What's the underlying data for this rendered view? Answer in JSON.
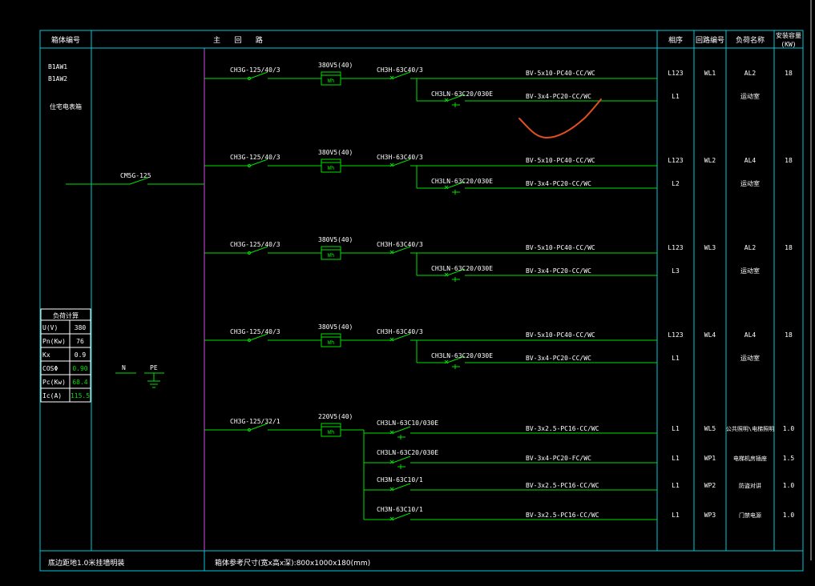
{
  "colors": {
    "background": "#000000",
    "frame": "#00c8d8",
    "wire": "#00e000",
    "busbar": "#b040c0",
    "text": "#ffffff",
    "annotation": "#e05020"
  },
  "header": {
    "col1": "箱体编号",
    "col2": "主 回 路",
    "col3": "相序",
    "col4": "回路编号",
    "col5": "负荷名称",
    "col6a": "安装容量",
    "col6b": "(KW)"
  },
  "left_panel": {
    "line1": "B1AW1",
    "line2": "B1AW2",
    "line3": "住宅电表箱",
    "main_breaker": "CM5G-125",
    "n_label": "N",
    "pe_label": "PE"
  },
  "calc_table": {
    "title": "负荷计算",
    "rows": [
      {
        "label": "U(V)",
        "value": "380"
      },
      {
        "label": "Pn(Kw)",
        "value": "76"
      },
      {
        "label": "Kx",
        "value": "0.9"
      },
      {
        "label": "COSΦ",
        "value": "0.90"
      },
      {
        "label": "Pc(Kw)",
        "value": "68.4"
      },
      {
        "label": "Ic(A)",
        "value": "115.5"
      }
    ]
  },
  "groups": [
    {
      "breaker": "CH3G-125/40/3",
      "meter": "380V5(40)",
      "meter_icon": "Wh",
      "main_sw": "CH3H-63C40/3",
      "main_cable": "BV-5x10-PC40-CC/WC",
      "main_phase": "L123",
      "circuit": "WL1",
      "load": "AL2",
      "capacity": "18",
      "sub_sw": "CH3LN-63C20/030E",
      "sub_cable": "BV-3x4-PC20-CC/WC",
      "sub_phase": "L1",
      "sub_load": "运动室"
    },
    {
      "breaker": "CH3G-125/40/3",
      "meter": "380V5(40)",
      "meter_icon": "Wh",
      "main_sw": "CH3H-63C40/3",
      "main_cable": "BV-5x10-PC40-CC/WC",
      "main_phase": "L123",
      "circuit": "WL2",
      "load": "AL4",
      "capacity": "18",
      "sub_sw": "CH3LN-63C20/030E",
      "sub_cable": "BV-3x4-PC20-CC/WC",
      "sub_phase": "L2",
      "sub_load": "运动室"
    },
    {
      "breaker": "CH3G-125/40/3",
      "meter": "380V5(40)",
      "meter_icon": "Wh",
      "main_sw": "CH3H-63C40/3",
      "main_cable": "BV-5x10-PC40-CC/WC",
      "main_phase": "L123",
      "circuit": "WL3",
      "load": "AL2",
      "capacity": "18",
      "sub_sw": "CH3LN-63C20/030E",
      "sub_cable": "BV-3x4-PC20-CC/WC",
      "sub_phase": "L3",
      "sub_load": "运动室"
    },
    {
      "breaker": "CH3G-125/40/3",
      "meter": "380V5(40)",
      "meter_icon": "Wh",
      "main_sw": "CH3H-63C40/3",
      "main_cable": "BV-5x10-PC40-CC/WC",
      "main_phase": "L123",
      "circuit": "WL4",
      "load": "AL4",
      "capacity": "18",
      "sub_sw": "CH3LN-63C20/030E",
      "sub_cable": "BV-3x4-PC20-CC/WC",
      "sub_phase": "L1",
      "sub_load": "运动室"
    }
  ],
  "group5": {
    "breaker": "CH3G-125/32/1",
    "meter": "220V5(40)",
    "meter_icon": "Wh",
    "branches": [
      {
        "switch": "CH3LN-63C10/030E",
        "cable": "BV-3x2.5-PC16-CC/WC",
        "phase": "L1",
        "circuit": "WL5",
        "load": "公共照明\\电梯照明",
        "capacity": "1.0"
      },
      {
        "switch": "CH3LN-63C20/030E",
        "cable": "BV-3x4-PC20-FC/WC",
        "phase": "L1",
        "circuit": "WP1",
        "load": "电梯机房插座",
        "capacity": "1.5"
      },
      {
        "switch": "CH3N-63C10/1",
        "cable": "BV-3x2.5-PC16-CC/WC",
        "phase": "L1",
        "circuit": "WP2",
        "load": "防盗对讲",
        "capacity": "1.0"
      },
      {
        "switch": "CH3N-63C10/1",
        "cable": "BV-3x2.5-PC16-CC/WC",
        "phase": "L1",
        "circuit": "WP3",
        "load": "门禁电源",
        "capacity": "1.0"
      }
    ]
  },
  "footer": {
    "left": "底边距地1.0米挂墙明装",
    "right": "箱体参考尺寸(宽x高x深):800x1000x180(mm)"
  }
}
